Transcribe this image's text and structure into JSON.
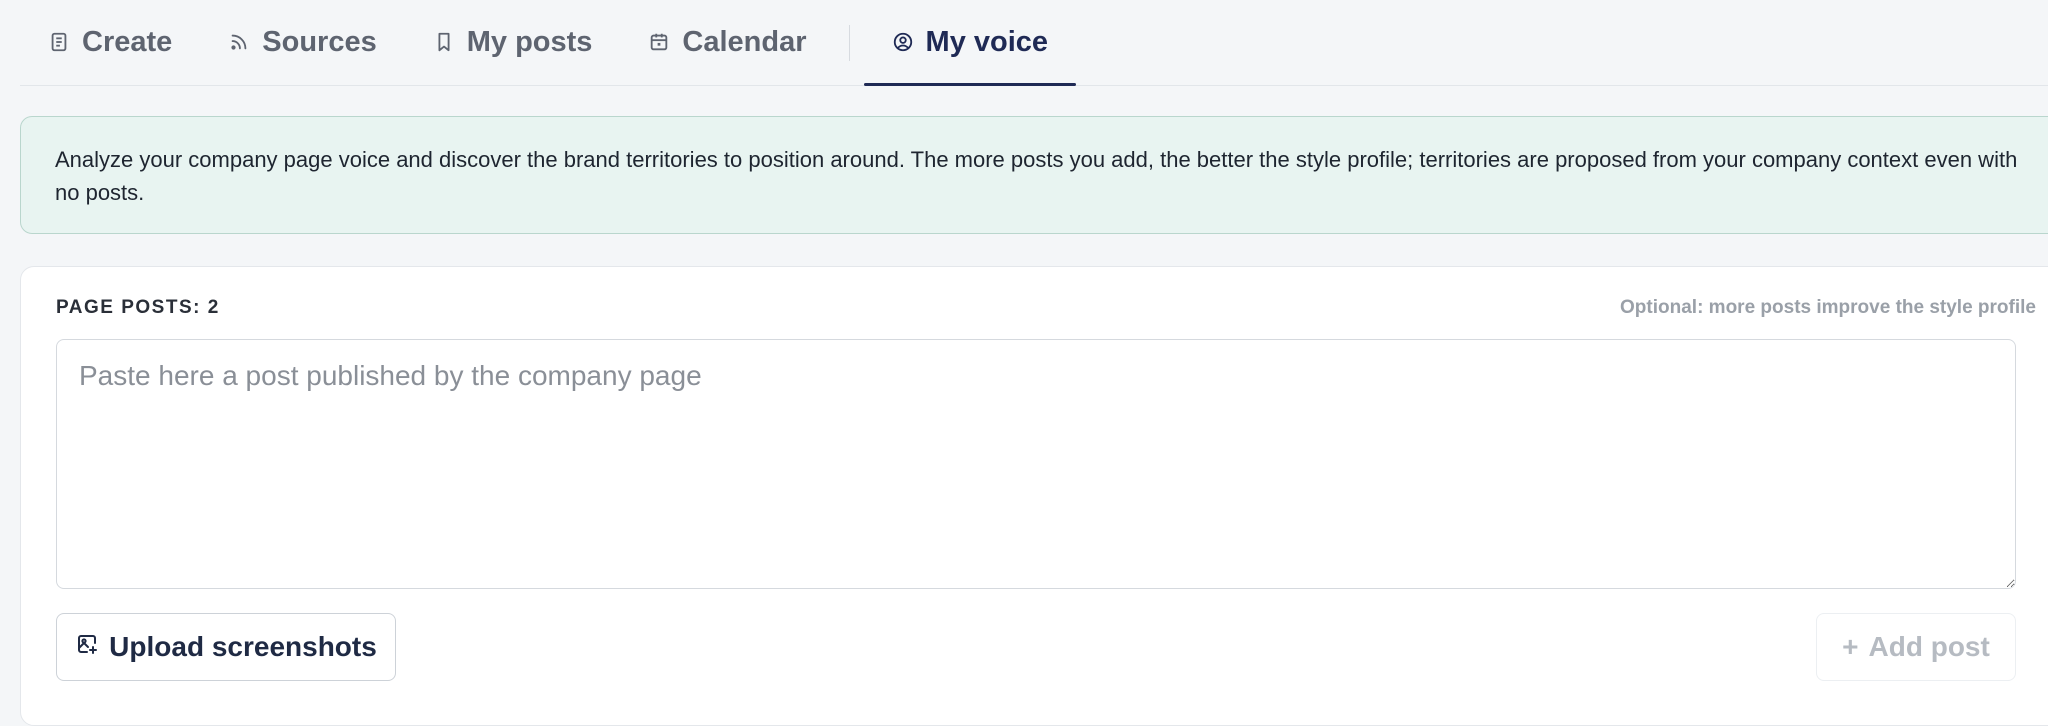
{
  "tabs": [
    {
      "label": "Create",
      "icon": "document-icon",
      "active": false
    },
    {
      "label": "Sources",
      "icon": "rss-icon",
      "active": false
    },
    {
      "label": "My posts",
      "icon": "bookmark-icon",
      "active": false
    },
    {
      "label": "Calendar",
      "icon": "calendar-icon",
      "active": false
    },
    {
      "label": "My voice",
      "icon": "user-circle-icon",
      "active": true
    }
  ],
  "banner": {
    "text": "Analyze your company page voice and discover the brand territories to position around. The more posts you add, the better the style profile; territories are proposed from your company context even with no posts."
  },
  "card": {
    "posts_count_label": "PAGE POSTS: 2",
    "optional_note": "Optional: more posts improve the style profile",
    "textarea": {
      "value": "",
      "placeholder": "Paste here a post published by the company page"
    },
    "upload_button": {
      "label": "Upload screenshots",
      "icon": "image-upload-icon"
    },
    "add_button": {
      "label": "Add post",
      "icon": "plus-icon",
      "disabled": true
    }
  },
  "colors": {
    "accent": "#1f2a55",
    "banner_bg": "#e8f4f1",
    "banner_border": "#b9d6cd",
    "page_bg": "#f4f6f8"
  }
}
